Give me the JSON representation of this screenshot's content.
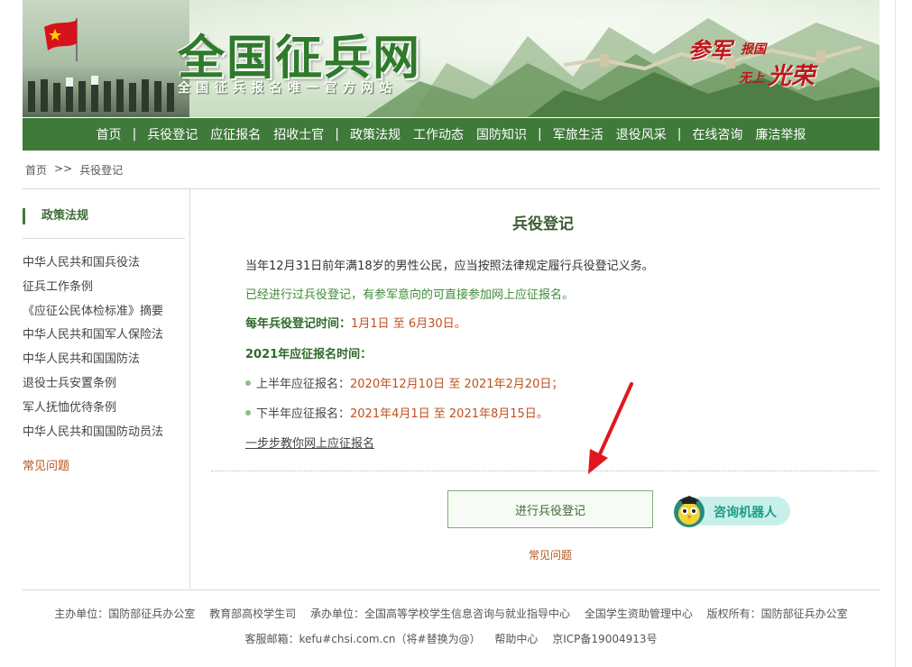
{
  "header": {
    "logo_title": "全国征兵网",
    "logo_subtitle": "全国征兵报名唯一官方网站",
    "slogan": {
      "part1": "参军",
      "part2": "报国",
      "part3": "无上",
      "part4": "光荣"
    }
  },
  "nav": {
    "items": [
      "首页",
      "兵役登记",
      "应征报名",
      "招收士官",
      "政策法规",
      "工作动态",
      "国防知识",
      "军旅生活",
      "退役风采",
      "在线咨询",
      "廉洁举报"
    ],
    "separator": "|"
  },
  "breadcrumb": {
    "home": "首页",
    "sep": ">>",
    "current": "兵役登记"
  },
  "sidebar": {
    "title": "政策法规",
    "items": [
      "中华人民共和国兵役法",
      "征兵工作条例",
      "《应征公民体检标准》摘要",
      "中华人民共和国军人保险法",
      "中华人民共和国国防法",
      "退役士兵安置条例",
      "军人抚恤优待条例",
      "中华人民共和国国防动员法"
    ],
    "faq": "常见问题"
  },
  "main": {
    "title": "兵役登记",
    "p1": "当年12月31日前年满18岁的男性公民，应当按照法律规定履行兵役登记义务。",
    "p2": "已经进行过兵役登记，有参军意向的可直接参加网上应征报名。",
    "p3_label": "每年兵役登记时间：",
    "p3_date": "1月1日 至 6月30日。",
    "p4": "2021年应征报名时间：",
    "bullet1_label": "上半年应征报名：",
    "bullet1_date": "2020年12月10日 至 2021年2月20日；",
    "bullet2_label": "下半年应征报名：",
    "bullet2_date": "2021年4月1日 至 2021年8月15日。",
    "guide_link": "一步步教你网上应征报名",
    "register_button": "进行兵役登记",
    "robot_label": "咨询机器人",
    "faq": "常见问题"
  },
  "footer": {
    "line1": [
      "主办单位：国防部征兵办公室",
      "教育部高校学生司",
      "承办单位：全国高等学校学生信息咨询与就业指导中心",
      "全国学生资助管理中心",
      "版权所有：国防部征兵办公室"
    ],
    "line2": [
      "客服邮箱：kefu#chsi.com.cn（将#替换为@）",
      "帮助中心",
      "京ICP备19004913号"
    ]
  },
  "colors": {
    "nav_green": "#3f7a3a",
    "accent_orange": "#c0501e",
    "robot_teal": "#1f9c88",
    "arrow_red": "#e0181d"
  }
}
